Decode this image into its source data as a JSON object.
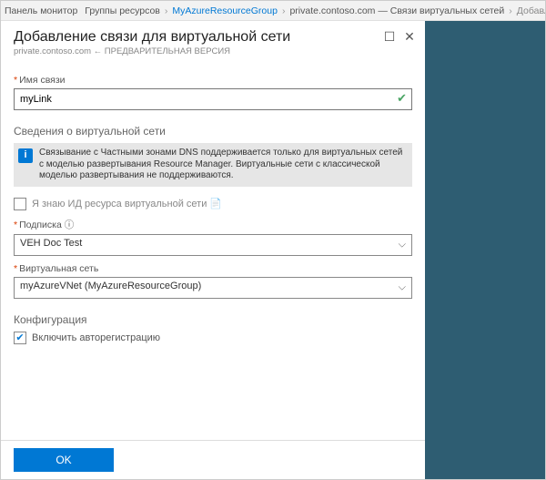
{
  "breadcrumb": {
    "item1": "Панель монитор",
    "item2": "Группы ресурсов",
    "item3": "MyAzureResourceGroup",
    "item4": "private.contoso.com — Связи виртуальных сетей",
    "last": "Добавление связи для"
  },
  "panel": {
    "title": "Добавление связи для виртуальной сети",
    "subtitle": "private.contoso.com ← ПРЕДВАРИТЕЛЬНАЯ ВЕРСИЯ"
  },
  "form": {
    "link_name_label": "Имя связи",
    "link_name_value": "myLink",
    "vnet_section": "Сведения о виртуальной сети",
    "info_text": "Связывание с Частными зонами DNS поддерживается только для виртуальных сетей с моделью развертывания Resource Manager. Виртуальные сети с классической моделью развертывания не поддерживаются.",
    "know_id_label": "Я знаю ИД ресурса виртуальной сети",
    "subscription_label": "Подписка",
    "subscription_value": "VEH Doc Test",
    "vnet_label": "Виртуальная сеть",
    "vnet_value": "myAzureVNet (MyAzureResourceGroup)",
    "config_section": "Конфигурация",
    "autoreg_label": "Включить авторегистрацию"
  },
  "footer": {
    "ok": "OK"
  },
  "icons": {
    "info_glyph": "i",
    "help_glyph": "ⓘ"
  }
}
